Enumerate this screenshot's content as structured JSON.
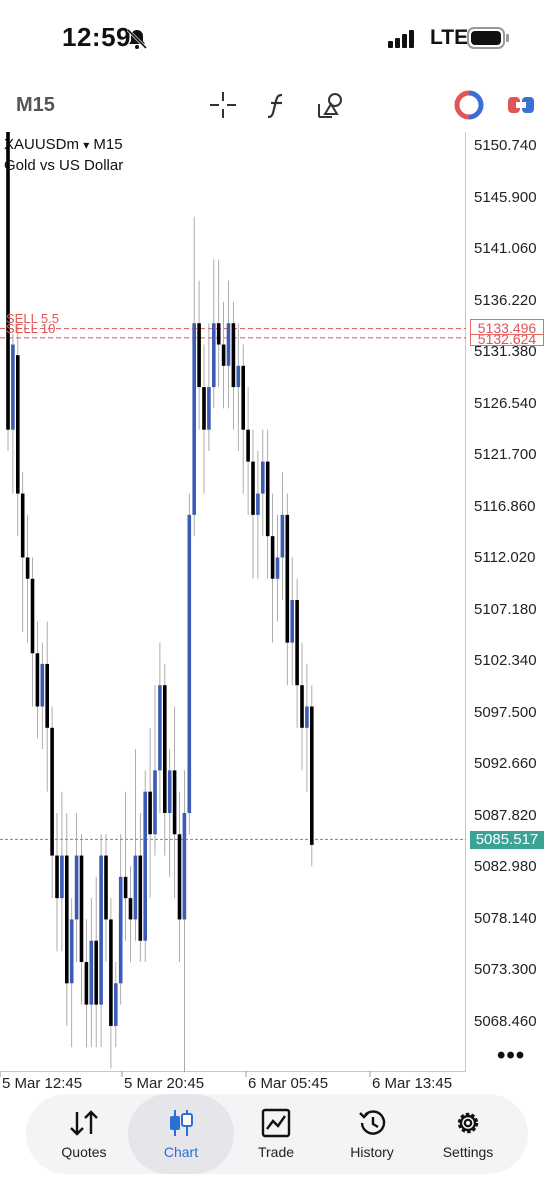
{
  "status_bar": {
    "time": "12:59",
    "network": "LTE"
  },
  "toolbar": {
    "timeframe": "M15",
    "icons": [
      "crosshair-icon",
      "function-icon",
      "objects-icon",
      "trade-icon",
      "one-click-icon"
    ]
  },
  "chart": {
    "symbol": "XAUUSDm",
    "symbol_arrow": "▾",
    "timeframe": "M15",
    "description": "Gold vs US Dollar",
    "price_scale": [
      "5150.740",
      "5145.900",
      "5141.060",
      "5136.220",
      "5131.380",
      "5126.540",
      "5121.700",
      "5116.860",
      "5112.020",
      "5107.180",
      "5102.340",
      "5097.500",
      "5092.660",
      "5087.820",
      "5082.980",
      "5078.140",
      "5073.300",
      "5068.460"
    ],
    "time_scale": [
      "5 Mar 12:45",
      "5 Mar 20:45",
      "6 Mar 05:45",
      "6 Mar 13:45"
    ],
    "bid_price": "5085.517",
    "orders": [
      {
        "label": "SELL 5.5",
        "price": "5133.496"
      },
      {
        "label": "SELL 10",
        "price": "5132.624"
      }
    ],
    "more": "•••",
    "colors": {
      "bull": "#3b5bb5",
      "bear": "#000000",
      "bid_line": "#3aa394",
      "sell_line": "#e05555"
    }
  },
  "tabs": [
    {
      "label": "Quotes",
      "icon": "quotes-arrows-icon",
      "active": false
    },
    {
      "label": "Chart",
      "icon": "chart-candles-icon",
      "active": true
    },
    {
      "label": "Trade",
      "icon": "trade-line-icon",
      "active": false
    },
    {
      "label": "History",
      "icon": "history-clock-icon",
      "active": false
    },
    {
      "label": "Settings",
      "icon": "settings-gear-icon",
      "active": false
    }
  ]
}
